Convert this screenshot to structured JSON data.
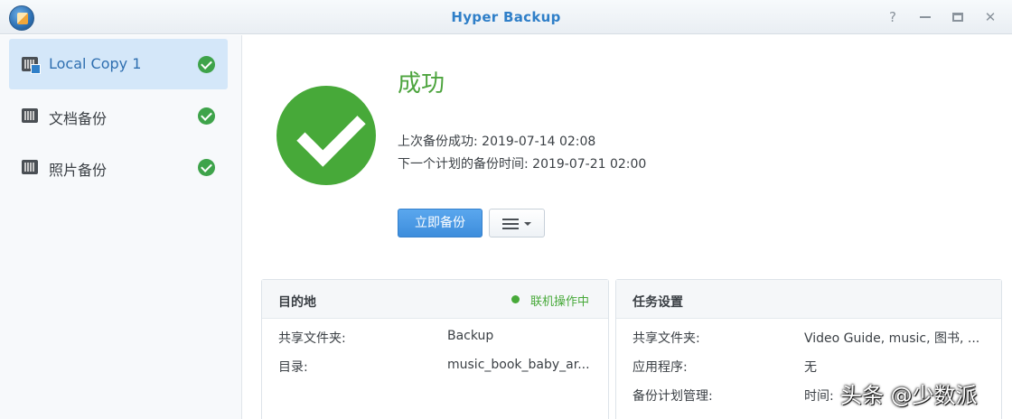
{
  "window": {
    "title": "Hyper Backup"
  },
  "sidebar": {
    "items": [
      {
        "label": "Local Copy 1",
        "icon": "local-copy-task-icon",
        "status": "success"
      },
      {
        "label": "文档备份",
        "icon": "backup-task-icon",
        "status": "success"
      },
      {
        "label": "照片备份",
        "icon": "backup-task-icon",
        "status": "success"
      }
    ]
  },
  "main": {
    "status_title": "成功",
    "last_backup": "上次备份成功: 2019-07-14 02:08",
    "next_backup": "下一个计划的备份时间: 2019-07-21 02:00",
    "backup_now_label": "立即备份"
  },
  "destination": {
    "title": "目的地",
    "status": "联机操作中",
    "rows": [
      {
        "label": "共享文件夹:",
        "value": "Backup"
      },
      {
        "label": "目录:",
        "value": "music_book_baby_ar..."
      }
    ]
  },
  "task_settings": {
    "title": "任务设置",
    "rows": [
      {
        "label": "共享文件夹:",
        "value": "Video Guide, music, 图书, ..."
      },
      {
        "label": "应用程序:",
        "value": "无"
      },
      {
        "label": "备份计划管理:",
        "value": "时间:"
      }
    ]
  },
  "watermark": "头条 @少数派",
  "colors": {
    "accent": "#2f7fc8",
    "success": "#47a939",
    "selected_bg": "#d4e7f9"
  }
}
